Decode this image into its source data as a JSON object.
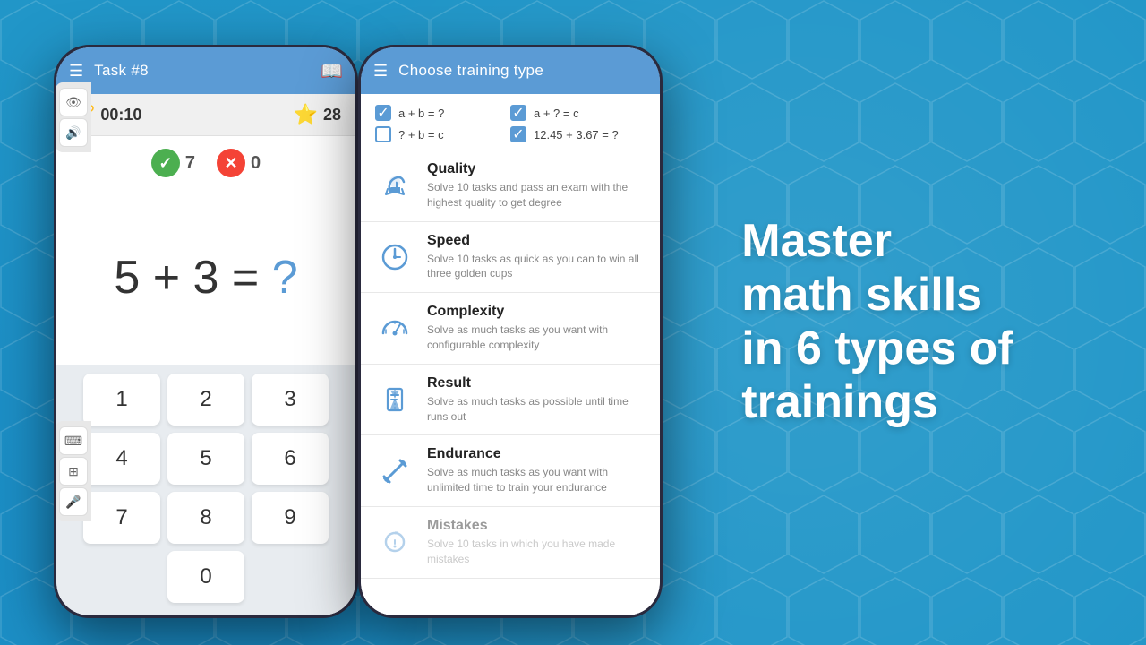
{
  "background": {
    "color": "#2196c8"
  },
  "tagline": {
    "line1": "Master",
    "line2": "math skills",
    "line3": "in 6 types of",
    "line4": "trainings"
  },
  "left_phone": {
    "app_bar": {
      "title": "Task #8",
      "menu_icon": "☰",
      "right_icon": "📖"
    },
    "stats": {
      "trophy_icon": "🏆",
      "timer": "00:10",
      "star_icon": "⭐",
      "star_count": "28"
    },
    "correct_count": "7",
    "wrong_count": "0",
    "equation": "5 + 3 = ?",
    "numpad": [
      "1",
      "2",
      "3",
      "4",
      "5",
      "6",
      "7",
      "8",
      "9",
      "0"
    ]
  },
  "right_phone": {
    "app_bar": {
      "title": "Choose training type",
      "menu_icon": "☰"
    },
    "checkboxes": [
      {
        "label": "a + b = ?",
        "checked": true
      },
      {
        "label": "a + ? = c",
        "checked": true
      },
      {
        "label": "? + b = c",
        "checked": false
      },
      {
        "label": "12.45 + 3.67 = ?",
        "checked": true
      }
    ],
    "training_items": [
      {
        "name": "Quality",
        "description": "Solve 10 tasks and pass an exam with the highest quality to get degree",
        "icon_type": "thumbsup"
      },
      {
        "name": "Speed",
        "description": "Solve 10 tasks as quick as you can to win all three golden cups",
        "icon_type": "timer"
      },
      {
        "name": "Complexity",
        "description": "Solve as much tasks as you want with configurable complexity",
        "icon_type": "gauge"
      },
      {
        "name": "Result",
        "description": "Solve as much tasks as possible until time runs out",
        "icon_type": "hourglass"
      },
      {
        "name": "Endurance",
        "description": "Solve as much tasks as you want with unlimited time to train your endurance",
        "icon_type": "dumbbell"
      },
      {
        "name": "Mistakes",
        "description": "Solve 10 tasks in which you have made mistakes",
        "icon_type": "history",
        "faded": true
      }
    ]
  }
}
